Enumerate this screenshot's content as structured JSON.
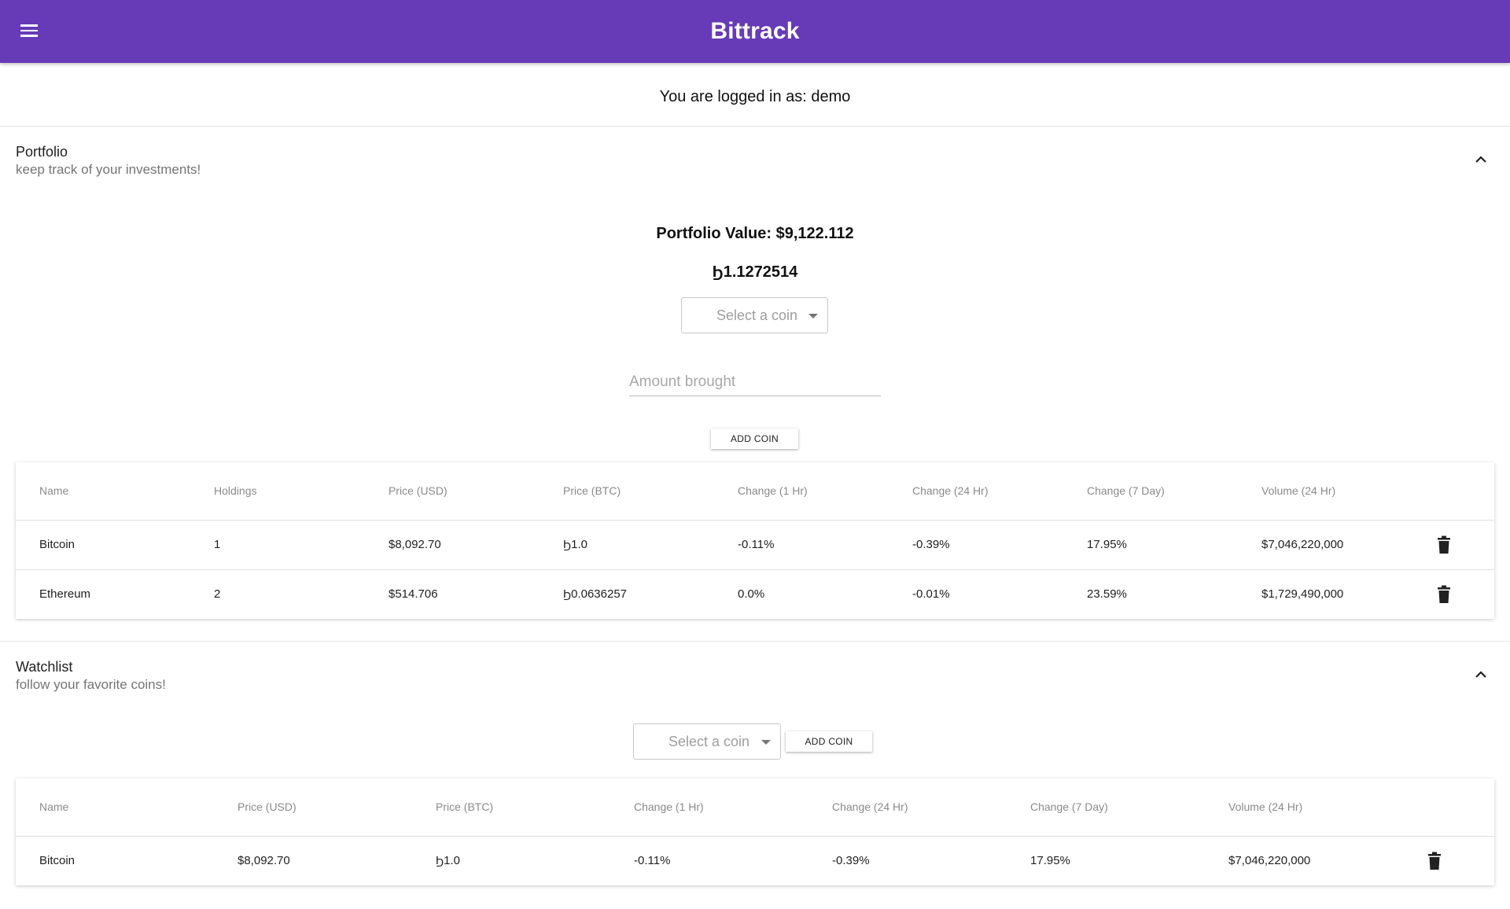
{
  "app": {
    "title": "Bittrack"
  },
  "login": {
    "text": "You are logged in as: demo"
  },
  "portfolio": {
    "title": "Portfolio",
    "subtitle": "keep track of your investments!",
    "value_text": "Portfolio Value: $9,122.112",
    "btc_value_text": "Ϧ1.1272514",
    "select_placeholder": "Select a coin",
    "amount_placeholder": "Amount brought",
    "add_button": "ADD COIN",
    "columns": [
      "Name",
      "Holdings",
      "Price (USD)",
      "Price (BTC)",
      "Change (1 Hr)",
      "Change (24 Hr)",
      "Change (7 Day)",
      "Volume (24 Hr)"
    ],
    "rows": [
      [
        "Bitcoin",
        "1",
        "$8,092.70",
        "Ϧ1.0",
        "-0.11%",
        "-0.39%",
        "17.95%",
        "$7,046,220,000"
      ],
      [
        "Ethereum",
        "2",
        "$514.706",
        "Ϧ0.0636257",
        "0.0%",
        "-0.01%",
        "23.59%",
        "$1,729,490,000"
      ]
    ]
  },
  "watchlist": {
    "title": "Watchlist",
    "subtitle": "follow your favorite coins!",
    "select_placeholder": "Select a coin",
    "add_button": "ADD COIN",
    "columns": [
      "Name",
      "Price (USD)",
      "Price (BTC)",
      "Change (1 Hr)",
      "Change (24 Hr)",
      "Change (7 Day)",
      "Volume (24 Hr)"
    ],
    "rows": [
      [
        "Bitcoin",
        "$8,092.70",
        "Ϧ1.0",
        "-0.11%",
        "-0.39%",
        "17.95%",
        "$7,046,220,000"
      ]
    ]
  },
  "icons": {
    "menu": "menu-icon",
    "chevron": "chevron-up-icon",
    "delete": "trash-icon",
    "dropdown": "caret-down-icon"
  },
  "colors": {
    "appbar": "#673ab7"
  }
}
